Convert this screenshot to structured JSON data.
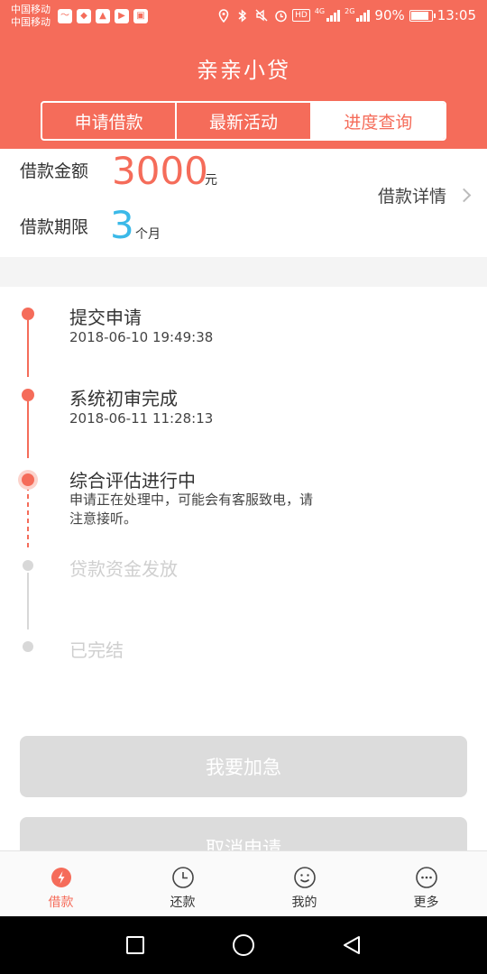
{
  "status_bar": {
    "carrier_1": "中国移动",
    "carrier_2": "中国移动",
    "network_1": "4G",
    "network_2": "2G",
    "battery": "90%",
    "battery_level": 0.9,
    "time": "13:05",
    "hd_label": "HD",
    "icons": [
      "location-icon",
      "bluetooth-icon",
      "mute-icon",
      "alarm-icon"
    ]
  },
  "header": {
    "title": "亲亲小贷",
    "tabs": [
      {
        "label": "申请借款",
        "active": false
      },
      {
        "label": "最新活动",
        "active": false
      },
      {
        "label": "进度查询",
        "active": true
      }
    ]
  },
  "loan_summary": {
    "amount_label": "借款金额",
    "amount_value": "3000",
    "amount_unit": "元",
    "term_label": "借款期限",
    "term_value": "3",
    "term_unit": "个月",
    "detail_link": "借款详情"
  },
  "timeline": {
    "steps": [
      {
        "title": "提交申请",
        "time": "2018-06-10 19:49:38",
        "status": "done"
      },
      {
        "title": "系统初审完成",
        "time": "2018-06-11 11:28:13",
        "status": "done"
      },
      {
        "title": "综合评估进行中",
        "desc": "申请正在处理中，可能会有客服致电，请注意接听。",
        "status": "current"
      },
      {
        "title": "贷款资金发放",
        "status": "pending"
      },
      {
        "title": "已完结",
        "status": "pending"
      }
    ]
  },
  "actions": {
    "urgent_button": "我要加急",
    "cancel_button": "取消申请"
  },
  "bottom_nav": {
    "items": [
      {
        "label": "借款",
        "icon": "lightning-icon",
        "active": true
      },
      {
        "label": "还款",
        "icon": "clock-icon",
        "active": false
      },
      {
        "label": "我的",
        "icon": "smiley-icon",
        "active": false
      },
      {
        "label": "更多",
        "icon": "more-icon",
        "active": false
      }
    ]
  },
  "colors": {
    "brand": "#f56c5a",
    "term_accent": "#3bb9e8",
    "disabled_button": "#dcdcdc"
  }
}
